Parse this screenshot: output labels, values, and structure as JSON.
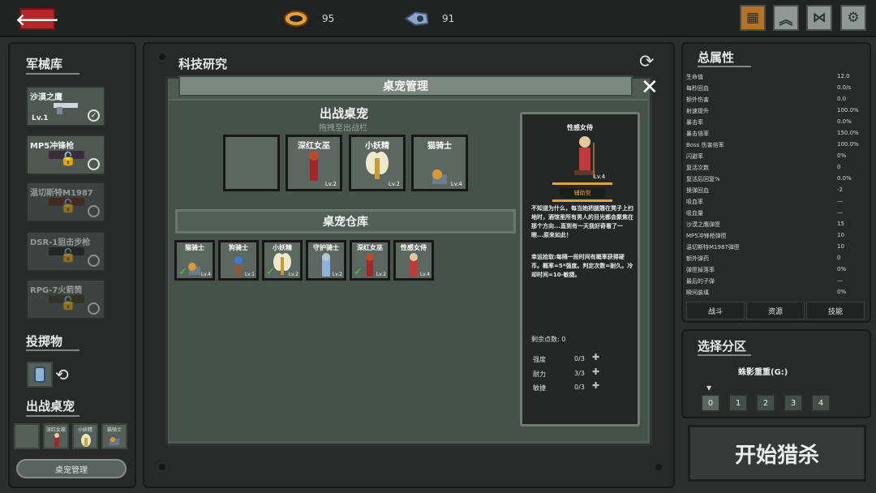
{
  "resources": {
    "ammo": "95",
    "gear": "91"
  },
  "armory": {
    "title": "军械库",
    "weapons": [
      {
        "name": "沙漠之鹰",
        "level": "Lv.1",
        "check": "✓"
      },
      {
        "name": "MP5冲锋枪"
      },
      {
        "name": "温切斯特M1987"
      },
      {
        "name": "DSR-1狙击步枪"
      },
      {
        "name": "RPG-7火箭筒"
      }
    ]
  },
  "throwable": {
    "title": "投掷物"
  },
  "pets_left": {
    "title": "出战桌宠",
    "slots": [
      "深红女巫",
      "小妖精",
      "猫骑士"
    ],
    "manage_button": "桌宠管理"
  },
  "tech": {
    "title": "科技研究"
  },
  "dialog": {
    "title": "桌宠管理",
    "battle": {
      "title": "出战桌宠",
      "hint": "拖拽至出战栏",
      "slots": [
        {
          "name": "",
          "level": ""
        },
        {
          "name": "深红女巫",
          "level": "Lv.2"
        },
        {
          "name": "小妖精",
          "level": "Lv.2"
        },
        {
          "name": "猫骑士",
          "level": "Lv.4"
        }
      ]
    },
    "warehouse": {
      "title": "桌宠仓库",
      "items": [
        {
          "name": "猫骑士",
          "level": "Lv.4",
          "check": "✓"
        },
        {
          "name": "狗骑士",
          "level": "Lv.1",
          "check": ""
        },
        {
          "name": "小妖精",
          "level": "Lv.2",
          "check": "✓"
        },
        {
          "name": "守护骑士",
          "level": "Lv.2",
          "check": ""
        },
        {
          "name": "深红女巫",
          "level": "Lv.2",
          "check": "✓"
        },
        {
          "name": "性感女侍",
          "level": "Lv.4",
          "check": ""
        }
      ]
    },
    "detail": {
      "name": "性感女侍",
      "level": "Lv.4",
      "type": "辅助型",
      "desc1": "不知道为什么，每当她把腿翘在凳子上扫地时，酒馆里所有男人的目光都会聚焦在那个方向...直到有一天我好奇看了一眼...原来如此！",
      "desc2": "幸运拾取:每隔一段时间有概率获得硬币。概率=5*强度。判定次数=耐久。冷却时间=10-敏捷。",
      "points": "剩余点数: 0",
      "stats": [
        {
          "label": "强度",
          "value": "0/3",
          "plus": "✚"
        },
        {
          "label": "耐力",
          "value": "3/3",
          "plus": "✚"
        },
        {
          "label": "敏捷",
          "value": "0/3",
          "plus": "✚"
        }
      ]
    }
  },
  "attributes": {
    "title": "总属性",
    "rows": [
      {
        "k": "生命值",
        "v": "12.0"
      },
      {
        "k": "每秒回血",
        "v": "0.0/s"
      },
      {
        "k": "额外伤害",
        "v": "0.0"
      },
      {
        "k": "射速提升",
        "v": "100.0%"
      },
      {
        "k": "暴击率",
        "v": "0.0%"
      },
      {
        "k": "暴击倍率",
        "v": "150.0%"
      },
      {
        "k": "Boss 伤害倍率",
        "v": "100.0%"
      },
      {
        "k": "闪避率",
        "v": "0%"
      },
      {
        "k": "复活次数",
        "v": "0"
      },
      {
        "k": "复活后回复%",
        "v": "0.0%"
      },
      {
        "k": "换弹回血",
        "v": "-2"
      },
      {
        "k": "吸血率",
        "v": "—"
      },
      {
        "k": "吸血量",
        "v": "—"
      },
      {
        "k": "沙漠之鹰弹匣",
        "v": "15"
      },
      {
        "k": "MP5冲锋枪弹匣",
        "v": "10"
      },
      {
        "k": "温切斯特M1987弹匣",
        "v": "10"
      },
      {
        "k": "额外弹药",
        "v": "0"
      },
      {
        "k": "弹匣掉落率",
        "v": "0%"
      },
      {
        "k": "最后的子弹",
        "v": "—"
      },
      {
        "k": "瞬间装填",
        "v": "0%"
      }
    ],
    "tabs": [
      "战斗",
      "资源",
      "技能"
    ]
  },
  "zone": {
    "title": "选择分区",
    "name": "蛛影重重(G:)",
    "options": [
      "0",
      "1",
      "2",
      "3",
      "4"
    ]
  },
  "start_button": "开始猎杀",
  "colors": {
    "red": "#b3272a",
    "green": "#35d43a",
    "accent": "#e2a23a"
  }
}
